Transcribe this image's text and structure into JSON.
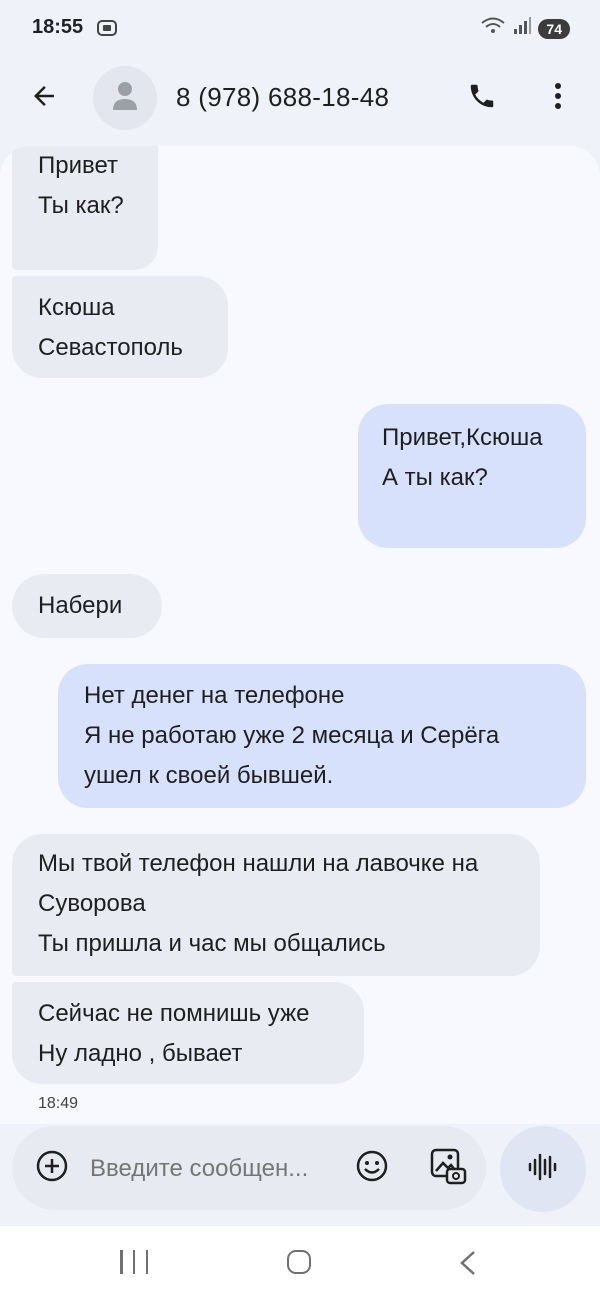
{
  "status_bar": {
    "time": "18:55",
    "battery": "74"
  },
  "header": {
    "contact": "8 (978) 688-18-48"
  },
  "messages": [
    {
      "direction": "incoming",
      "lines": [
        "Привет",
        "Ты как?"
      ]
    },
    {
      "direction": "incoming",
      "lines": [
        "Ксюша",
        "Севастополь"
      ]
    },
    {
      "direction": "outgoing",
      "lines": [
        "Привет,Ксюша",
        "А ты как?"
      ]
    },
    {
      "direction": "incoming",
      "lines": [
        "Набери"
      ]
    },
    {
      "direction": "outgoing",
      "lines": [
        "Нет денег на телефоне",
        "Я не работаю уже 2 месяца и Серёга",
        "ушел к своей бывшей."
      ]
    },
    {
      "direction": "incoming",
      "lines": [
        "Мы твой телефон нашли на лавочке на",
        "Суворова",
        "Ты пришла и час мы общались"
      ]
    },
    {
      "direction": "incoming",
      "lines": [
        "Сейчас не помнишь уже",
        "Ну ладно , бывает"
      ]
    }
  ],
  "last_timestamp": "18:49",
  "composer": {
    "placeholder": "Введите сообщен..."
  },
  "icons": {
    "back": "arrow-left-icon",
    "avatar": "person-icon",
    "call": "phone-icon",
    "more": "more-vert-icon",
    "add": "add-circle-icon",
    "emoji": "emoji-icon",
    "gallery": "gallery-icon",
    "voice": "voice-waveform-icon"
  },
  "colors": {
    "incoming_bubble": "#e9ebf3",
    "outgoing_bubble": "#d7e1fc",
    "background": "#f0f2f9"
  }
}
